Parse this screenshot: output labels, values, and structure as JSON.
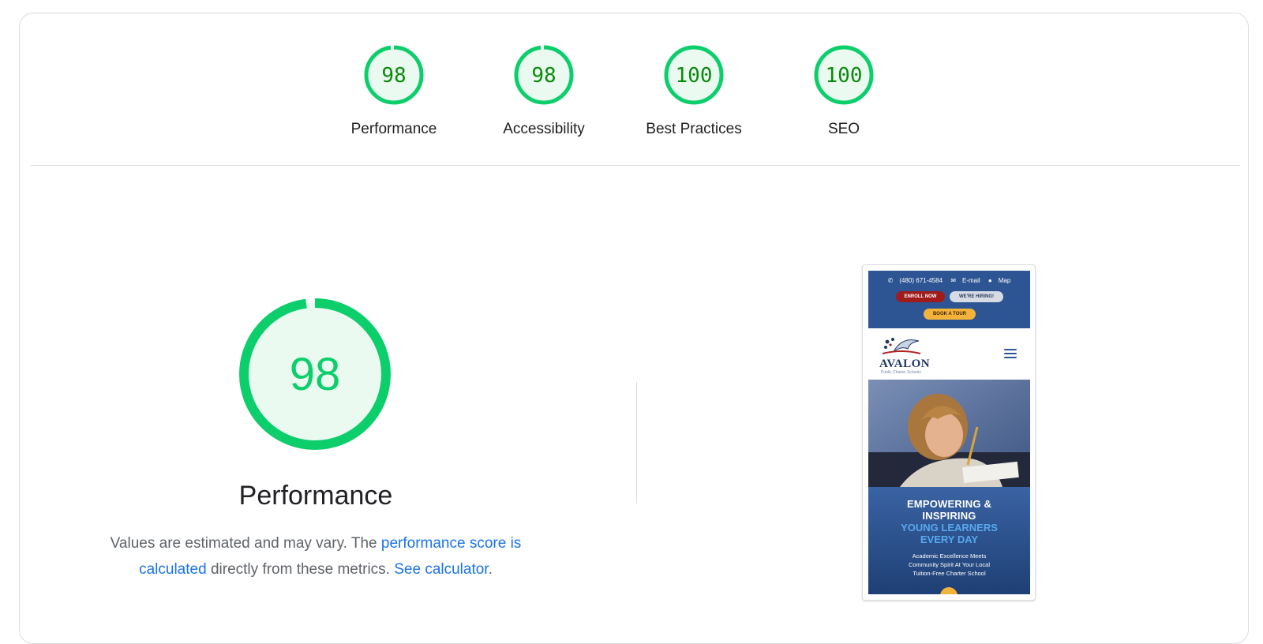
{
  "colors": {
    "pass_green": "#0cce6b",
    "score_text_green": "#0a8a0a",
    "gauge_fill": "#eafaf1",
    "link_blue": "#1a73e8"
  },
  "categories": [
    {
      "label": "Performance",
      "score": 98
    },
    {
      "label": "Accessibility",
      "score": 98
    },
    {
      "label": "Best Practices",
      "score": 100
    },
    {
      "label": "SEO",
      "score": 100
    }
  ],
  "main": {
    "score": 98,
    "title": "Performance",
    "desc_prefix": "Values are estimated and may vary. The ",
    "desc_link1": "performance score is calculated",
    "desc_mid": " directly from these metrics. ",
    "desc_link2": "See calculator",
    "desc_suffix": "."
  },
  "screenshot": {
    "phone": "(480) 671-4584",
    "email": "E-mail",
    "map": "Map",
    "enroll": "ENROLL NOW",
    "hiring": "WE'RE HIRING!",
    "tour": "BOOK A TOUR",
    "logo": "AVALON",
    "logo_sub": "Public Charter Schools",
    "hero_line1": "EMPOWERING &",
    "hero_line2": "INSPIRING",
    "hero_line3": "YOUNG LEARNERS",
    "hero_line4": "EVERY DAY",
    "hero_p1": "Academic Excellence Meets",
    "hero_p2": "Community Spirit At Your Local",
    "hero_p3": "Tuition-Free Charter School"
  }
}
